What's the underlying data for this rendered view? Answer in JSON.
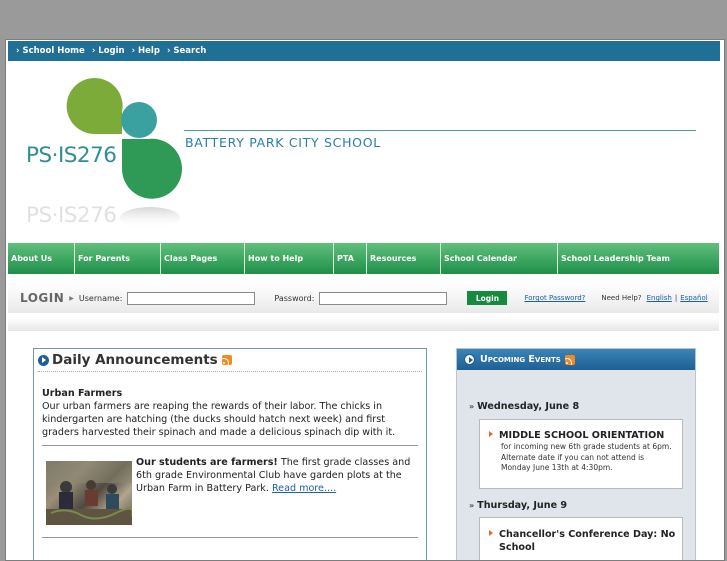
{
  "topnav": {
    "items": [
      "› School Home",
      "› Login",
      "› Help",
      "› Search"
    ]
  },
  "header": {
    "logo_text": "PS·IS276",
    "logo_reflection": "PS·IS276",
    "school_name": "BATTERY PARK CITY SCHOOL"
  },
  "mainnav": {
    "items": [
      "About Us",
      "For Parents",
      "Class Pages",
      "How to Help",
      "PTA",
      "Resources",
      "School Calendar",
      "School Leadership Team"
    ]
  },
  "login": {
    "title": "LOGIN",
    "username_label": "Username:",
    "password_label": "Password:",
    "button_label": "Login",
    "forgot_label": "Forgot Password?",
    "help_label": "Need Help?",
    "english_label": "English",
    "sep": "|",
    "espanol_label": "Español"
  },
  "announcements": {
    "title": "Daily Announcements",
    "items": [
      {
        "title": "Urban Farmers",
        "body": "Our urban farmers are reaping the rewards of their labor. The chicks in kindergarten are hatching (the ducks should hatch next week) and first graders harvested their spinach and made a delicious spinach dip with it."
      },
      {
        "title": "Our students are farmers!",
        "body": " The first grade classes and 6th grade Environmental Club have garden plots at the Urban Farm in Battery Park. ",
        "link": "Read more...."
      }
    ]
  },
  "events": {
    "title": "Upcoming Events",
    "days": [
      {
        "date": "Wednesday, June 8",
        "name": "MIDDLE SCHOOL ORIENTATION",
        "desc": "for incoming new 6th grade students at 6pm. Alternate date if you can not attend is Monday June 13th at 4:30pm."
      },
      {
        "date": "Thursday, June 9",
        "name": "Chancellor's Conference Day: No School"
      }
    ]
  },
  "colors": {
    "topnav": "#1f6f96",
    "mainnav": "#1f8f4a",
    "login_button": "#168a3e",
    "logo_green": "#7dab3a",
    "logo_teal": "#3aa0a0",
    "logo_dark_green": "#2f9a55",
    "school_name": "#2a7fa8"
  }
}
